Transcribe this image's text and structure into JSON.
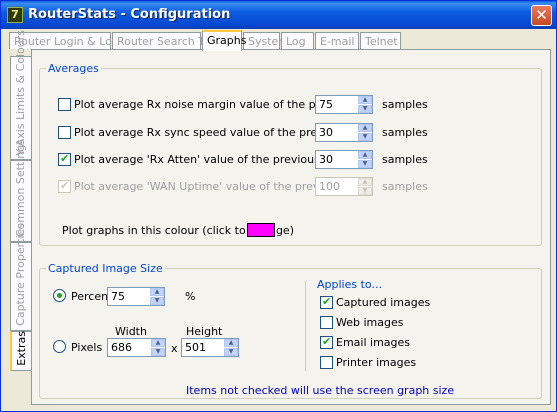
{
  "window": {
    "title": "RouterStats - Configuration",
    "icon": "router-app-icon"
  },
  "top_tabs": [
    {
      "label": "Router Login & Logout"
    },
    {
      "label": "Router Search Text"
    },
    {
      "label": "Graphs",
      "active": true
    },
    {
      "label": "System"
    },
    {
      "label": "Log"
    },
    {
      "label": "E-mail"
    },
    {
      "label": "Telnet"
    }
  ],
  "side_tabs": [
    {
      "label": "Y-Axis Limits & Colours"
    },
    {
      "label": "Common Settings"
    },
    {
      "label": "Capture Properties"
    },
    {
      "label": "Extras",
      "active": true
    }
  ],
  "averages": {
    "title": "Averages",
    "rows": [
      {
        "label": "Plot average Rx noise margin value of the previous..",
        "checked": false,
        "value": "75",
        "unit": "samples",
        "enabled": true
      },
      {
        "label": "Plot average Rx sync speed value of the previous..",
        "checked": false,
        "value": "30",
        "unit": "samples",
        "enabled": true
      },
      {
        "label": "Plot average 'Rx Atten' value of the previous..",
        "checked": true,
        "value": "30",
        "unit": "samples",
        "enabled": true
      },
      {
        "label": "Plot average 'WAN Uptime' value of the previous..",
        "checked": true,
        "value": "100",
        "unit": "samples",
        "enabled": false
      }
    ],
    "colour_label": "Plot graphs in this colour (click to change)",
    "colour": "#ff00ff"
  },
  "captured": {
    "title": "Captured Image Size",
    "percent_label": "Percent",
    "percent_value": "75",
    "percent_unit": "%",
    "width_label": "Width",
    "height_label": "Height",
    "pixels_label": "Pixels",
    "width_value": "686",
    "x_label": "x",
    "height_value": "501",
    "applies_title": "Applies to...",
    "applies": [
      {
        "label": "Captured images",
        "checked": true
      },
      {
        "label": "Web images",
        "checked": false
      },
      {
        "label": "Email images",
        "checked": true
      },
      {
        "label": "Printer images",
        "checked": false
      }
    ],
    "note": "Items not checked will use the screen graph size"
  }
}
